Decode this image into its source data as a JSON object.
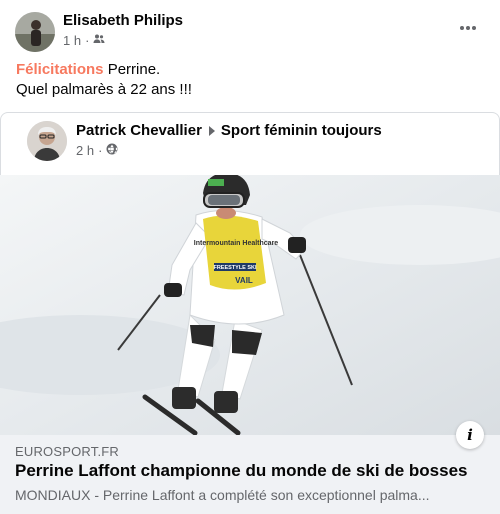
{
  "post": {
    "author": "Elisabeth Philips",
    "time": "1 h",
    "separator": "·",
    "audience_icon": "friends-icon",
    "text_highlight": "Félicitations",
    "text_rest": " Perrine.",
    "text_line2": "Quel palmarès à 22 ans !!!"
  },
  "shared": {
    "author": "Patrick Chevallier",
    "group": "Sport féminin toujours",
    "time": "2 h",
    "separator": "·",
    "audience_icon": "globe-icon"
  },
  "link": {
    "domain": "EUROSPORT.FR",
    "title": "Perrine Laffont championne du monde de ski de bosses",
    "description": "MONDIAUX - Perrine Laffont a complété son exceptionnel palma...",
    "info_label": "i"
  },
  "bib": {
    "sponsor": "Intermountain Healthcare",
    "event": "FREESTYLE SKI",
    "venue": "VAIL"
  },
  "colors": {
    "highlight": "#f7795f",
    "bib_yellow": "#e8d53a",
    "link_bg": "#f0f2f5"
  }
}
